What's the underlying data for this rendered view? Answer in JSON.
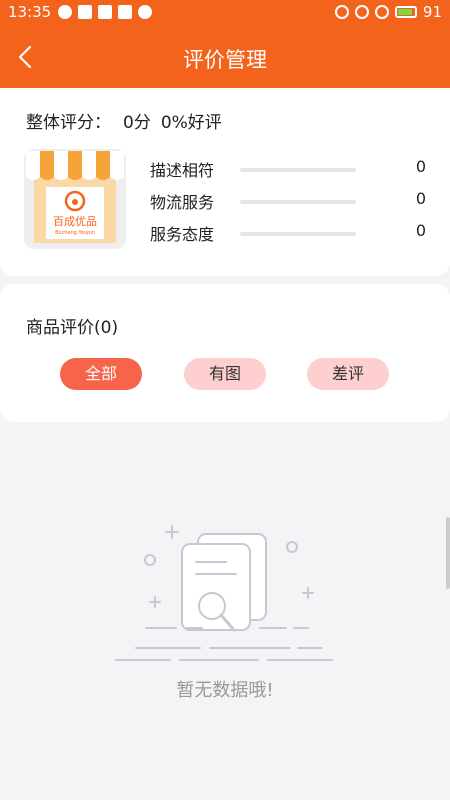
{
  "status_bar": {
    "time": "13:35",
    "battery": "91"
  },
  "header": {
    "title": "评价管理",
    "back_icon": "chevron-left-icon"
  },
  "overall": {
    "label": "整体评分：",
    "score": "0分",
    "good_rate": "0%好评"
  },
  "store": {
    "logo_text": "百成优品",
    "logo_subtext": "Bocheng Youpin",
    "brand_color": "#f4631b"
  },
  "ratings": [
    {
      "label": "描述相符",
      "value": "0"
    },
    {
      "label": "物流服务",
      "value": "0"
    },
    {
      "label": "服务态度",
      "value": "0"
    }
  ],
  "goods": {
    "title": "商品评价(0)",
    "filters": [
      {
        "label": "全部",
        "active": true
      },
      {
        "label": "有图",
        "active": false
      },
      {
        "label": "差评",
        "active": false
      }
    ]
  },
  "empty": {
    "text": "暂无数据哦!",
    "icon": "empty-document-search-icon"
  }
}
